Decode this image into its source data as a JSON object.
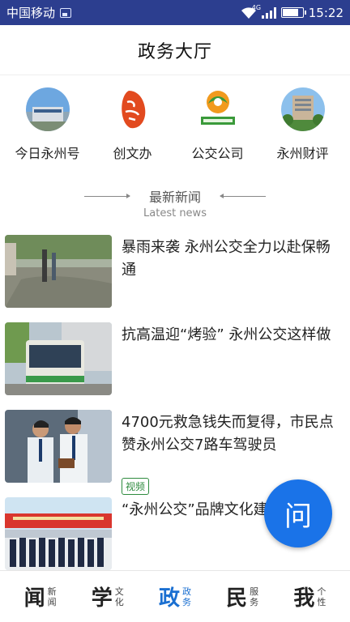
{
  "status_bar": {
    "carrier": "中国移动",
    "network": "4G",
    "time": "15:22",
    "battery_level": 0.85
  },
  "header": {
    "title": "政务大厅"
  },
  "quick_links": [
    {
      "label": "今日永州号",
      "icon": "building-photo-icon"
    },
    {
      "label": "创文办",
      "icon": "calligraphy-seal-icon"
    },
    {
      "label": "公交公司",
      "icon": "bus-company-logo-icon"
    },
    {
      "label": "永州财评",
      "icon": "office-building-photo-icon"
    }
  ],
  "section": {
    "title": "最新新闻",
    "subtitle": "Latest news"
  },
  "news": [
    {
      "title": "暴雨来袭 永州公交全力以赴保畅通",
      "thumb": "flooded-street-photo"
    },
    {
      "title": "抗高温迎“烤验” 永州公交这样做",
      "thumb": "bus-photo"
    },
    {
      "title": "4700元救急钱失而复得，市民点赞永州公交7路车驾驶员",
      "thumb": "drivers-photo",
      "tag": "视频"
    },
    {
      "title": "“永州公交”品牌文化建设",
      "thumb": "group-photo"
    }
  ],
  "ask_button": {
    "label": "问"
  },
  "bottom_nav": [
    {
      "big": "闻",
      "small1": "新",
      "small2": "闻",
      "active": false
    },
    {
      "big": "学",
      "small1": "文",
      "small2": "化",
      "active": false
    },
    {
      "big": "政",
      "small1": "政",
      "small2": "务",
      "active": true
    },
    {
      "big": "民",
      "small1": "服",
      "small2": "务",
      "active": false
    },
    {
      "big": "我",
      "small1": "个",
      "small2": "性",
      "active": false
    }
  ],
  "colors": {
    "status_bar": "#2c3e8f",
    "accent": "#1a73e8",
    "tag": "#2e8b3e"
  }
}
